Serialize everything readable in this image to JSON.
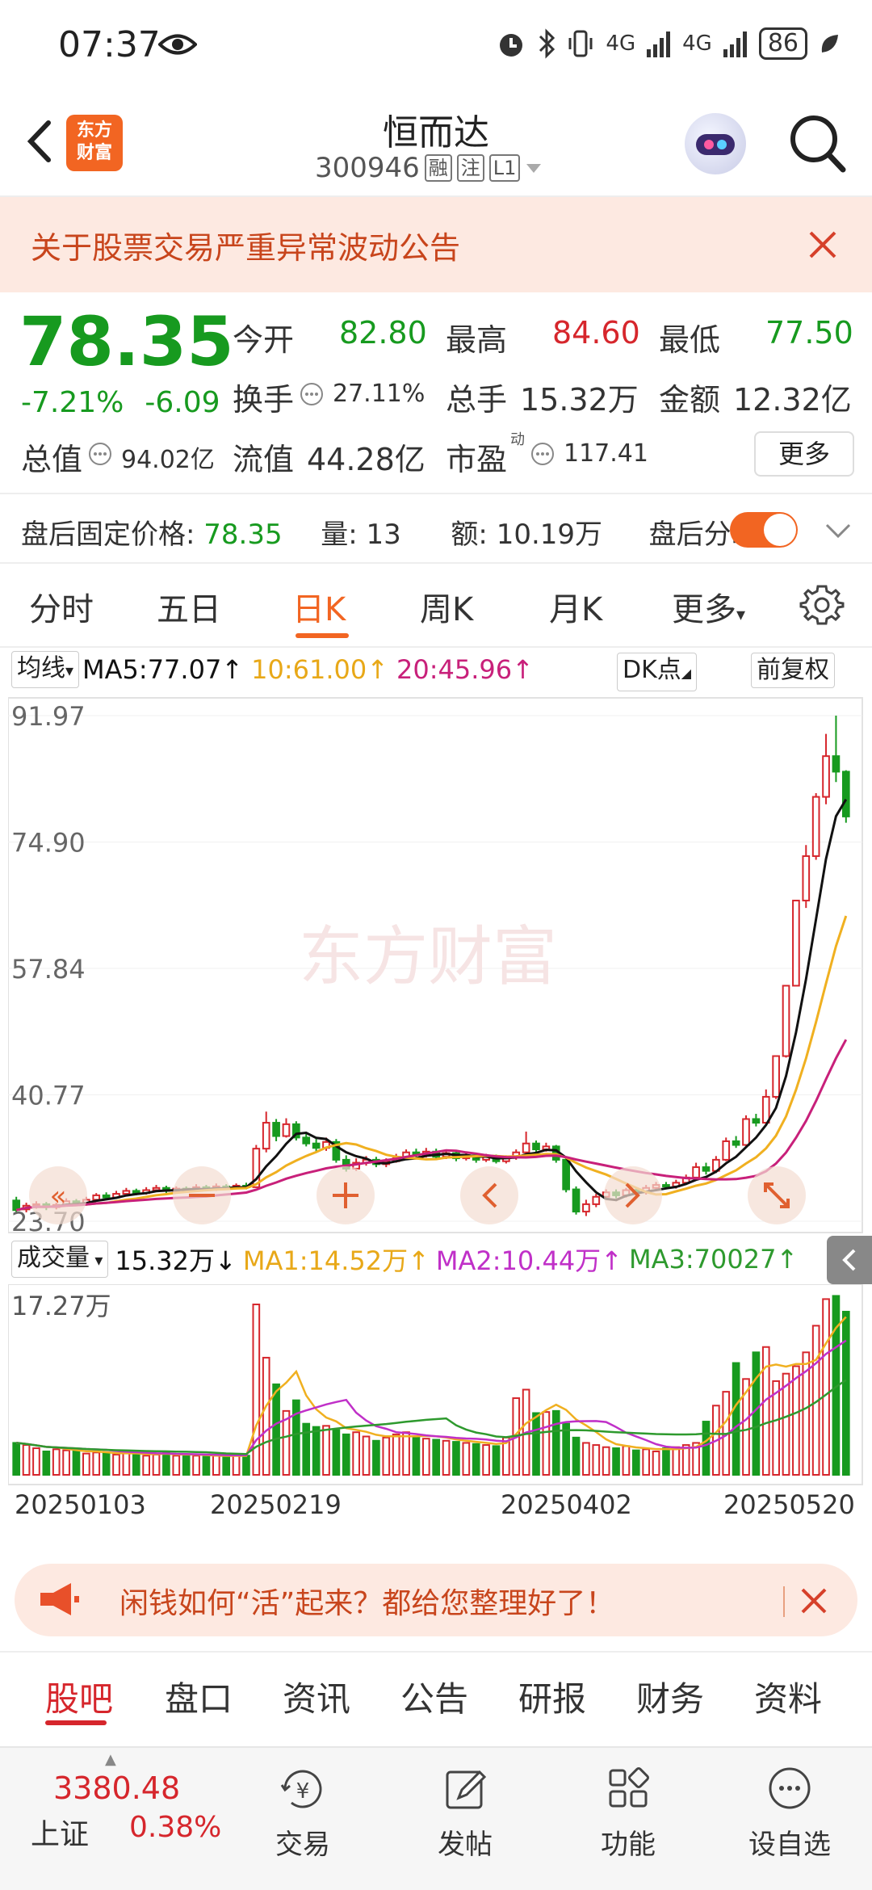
{
  "status_bar": {
    "time": "07:37",
    "network1": "4G",
    "network2": "4G",
    "battery": "86"
  },
  "header": {
    "stock_name": "恒而达",
    "stock_code": "300946",
    "tag_rong": "融",
    "tag_zhu": "注",
    "tag_level": "L1"
  },
  "notice": {
    "text": "关于股票交易严重异常波动公告"
  },
  "quote": {
    "price": "78.35",
    "change_pct": "-7.21%",
    "change": "-6.09",
    "open_label": "今开",
    "open": "82.80",
    "high_label": "最高",
    "high": "84.60",
    "low_label": "最低",
    "low": "77.50",
    "turnover_label": "换手",
    "turnover": "27.11%",
    "vol_label": "总手",
    "vol": "15.32万",
    "amount_label": "金额",
    "amount": "12.32亿",
    "mktcap_label": "总值",
    "mktcap": "94.02亿",
    "float_label": "流值",
    "float": "44.28亿",
    "pe_label": "市盈",
    "pe_sup": "动",
    "pe": "117.41",
    "more_label": "更多"
  },
  "after_hours": {
    "price_label": "盘后固定价格:",
    "price": "78.35",
    "vol_label": "量:",
    "vol": "13",
    "amount_label": "额:",
    "amount": "10.19万",
    "timeshare_label": "盘后分时"
  },
  "chart_tabs": [
    "分时",
    "五日",
    "日K",
    "周K",
    "月K",
    "更多"
  ],
  "active_chart_tab": "日K",
  "ma_row": {
    "selector": "均线",
    "ma5": "MA5:77.07↑",
    "ma10": "10:61.00↑",
    "ma20": "20:45.96↑",
    "dk_label": "DK点",
    "fuquan_label": "前复权"
  },
  "volume_row": {
    "selector": "成交量",
    "vol": "15.32万↓",
    "ma1": "MA1:14.52万↑",
    "ma2": "MA2:10.44万↑",
    "ma3": "MA3:70027↑"
  },
  "watermark": "东方财富",
  "colors": {
    "up": "#d6262c",
    "down": "#179a1f",
    "accent": "#f26522",
    "ma5": "#111111",
    "ma10": "#f0b020",
    "ma20": "#c8207a",
    "ma3": "#2e9a2e"
  },
  "chart_data": {
    "type": "candlestick",
    "y_ticks": [
      "91.97",
      "74.90",
      "57.84",
      "40.77",
      "23.70"
    ],
    "ylim": [
      23.7,
      91.97
    ],
    "vol_max_label": "17.27万",
    "x_tick_labels": [
      "20250103",
      "20250219",
      "20250402",
      "20250520"
    ],
    "candles": [
      [
        26.5,
        25.2,
        27.0,
        24.8
      ],
      [
        25.3,
        25.8,
        26.2,
        24.9
      ],
      [
        25.8,
        26.0,
        26.4,
        25.4
      ],
      [
        26.0,
        25.6,
        26.3,
        25.2
      ],
      [
        25.6,
        25.9,
        26.2,
        25.3
      ],
      [
        25.9,
        26.4,
        26.8,
        25.7
      ],
      [
        26.4,
        26.2,
        26.7,
        25.9
      ],
      [
        26.2,
        26.6,
        27.0,
        26.0
      ],
      [
        26.6,
        27.2,
        27.5,
        26.4
      ],
      [
        27.2,
        26.9,
        27.6,
        26.6
      ],
      [
        26.9,
        27.4,
        27.8,
        26.8
      ],
      [
        27.4,
        27.8,
        28.2,
        27.1
      ],
      [
        27.8,
        27.5,
        28.1,
        27.2
      ],
      [
        27.5,
        27.9,
        28.3,
        27.3
      ],
      [
        27.9,
        28.2,
        28.6,
        27.7
      ],
      [
        28.2,
        27.8,
        28.5,
        27.5
      ],
      [
        27.8,
        28.1,
        28.4,
        27.6
      ],
      [
        28.1,
        27.9,
        28.4,
        27.6
      ],
      [
        27.9,
        28.3,
        28.7,
        27.7
      ],
      [
        28.3,
        28.0,
        28.6,
        27.8
      ],
      [
        28.0,
        28.4,
        28.8,
        27.8
      ],
      [
        28.4,
        28.2,
        28.7,
        27.9
      ],
      [
        28.2,
        28.5,
        28.8,
        28.0
      ],
      [
        28.5,
        28.3,
        28.9,
        28.0
      ],
      [
        28.3,
        33.5,
        34.0,
        28.2
      ],
      [
        33.5,
        37.0,
        38.5,
        33.0
      ],
      [
        37.0,
        35.2,
        37.5,
        34.5
      ],
      [
        35.2,
        36.8,
        37.6,
        35.0
      ],
      [
        36.8,
        35.0,
        37.2,
        34.6
      ],
      [
        35.0,
        34.2,
        35.6,
        33.8
      ],
      [
        34.2,
        33.6,
        34.8,
        33.0
      ],
      [
        33.6,
        34.4,
        35.0,
        33.2
      ],
      [
        34.4,
        32.0,
        34.8,
        31.6
      ],
      [
        32.0,
        30.8,
        32.6,
        30.4
      ],
      [
        30.8,
        31.6,
        32.2,
        30.5
      ],
      [
        31.6,
        32.0,
        32.5,
        31.2
      ],
      [
        32.0,
        31.4,
        32.4,
        31.0
      ],
      [
        31.4,
        31.8,
        32.2,
        31.0
      ],
      [
        31.8,
        32.2,
        32.8,
        31.6
      ],
      [
        32.2,
        33.0,
        33.4,
        32.0
      ],
      [
        33.0,
        32.6,
        33.5,
        32.2
      ],
      [
        32.6,
        33.1,
        33.6,
        32.3
      ],
      [
        33.1,
        32.4,
        33.5,
        32.0
      ],
      [
        32.4,
        32.9,
        33.3,
        32.1
      ],
      [
        32.9,
        32.2,
        33.2,
        31.8
      ],
      [
        32.2,
        32.6,
        33.0,
        31.9
      ],
      [
        32.6,
        32.0,
        32.9,
        31.6
      ],
      [
        32.0,
        32.4,
        32.8,
        31.7
      ],
      [
        32.4,
        31.8,
        32.7,
        31.5
      ],
      [
        31.8,
        32.3,
        32.6,
        31.5
      ],
      [
        32.3,
        33.0,
        33.4,
        32.0
      ],
      [
        33.0,
        34.2,
        35.8,
        32.8
      ],
      [
        34.2,
        33.4,
        34.6,
        33.0
      ],
      [
        33.4,
        33.8,
        34.3,
        33.1
      ],
      [
        33.8,
        32.0,
        34.0,
        31.6
      ],
      [
        32.0,
        28.0,
        32.2,
        27.6
      ],
      [
        28.0,
        25.0,
        28.4,
        24.6
      ],
      [
        25.0,
        26.0,
        26.6,
        24.4
      ],
      [
        26.0,
        27.0,
        27.4,
        25.6
      ],
      [
        27.0,
        27.6,
        28.0,
        26.6
      ],
      [
        27.6,
        27.2,
        28.0,
        26.8
      ],
      [
        27.2,
        27.9,
        28.2,
        26.9
      ],
      [
        27.9,
        27.6,
        28.3,
        27.2
      ],
      [
        27.6,
        28.2,
        28.6,
        27.3
      ],
      [
        28.2,
        28.6,
        29.0,
        27.9
      ],
      [
        28.6,
        28.4,
        29.0,
        28.0
      ],
      [
        28.4,
        28.9,
        29.3,
        28.1
      ],
      [
        28.9,
        29.6,
        30.0,
        28.6
      ],
      [
        29.6,
        31.0,
        31.6,
        29.3
      ],
      [
        31.0,
        30.5,
        31.6,
        30.0
      ],
      [
        30.5,
        32.0,
        32.5,
        30.2
      ],
      [
        32.0,
        34.5,
        35.0,
        31.8
      ],
      [
        34.5,
        34.0,
        35.2,
        33.6
      ],
      [
        34.0,
        37.5,
        38.0,
        33.8
      ],
      [
        37.5,
        37.0,
        38.2,
        36.5
      ],
      [
        37.0,
        40.5,
        41.5,
        36.8
      ],
      [
        40.5,
        46.0,
        46.0,
        40.2
      ],
      [
        46.0,
        55.5,
        55.5,
        45.8
      ],
      [
        55.5,
        67.0,
        67.0,
        55.5
      ],
      [
        67.0,
        73.0,
        74.5,
        66.0
      ],
      [
        73.0,
        81.0,
        81.5,
        72.5
      ],
      [
        81.0,
        86.5,
        89.5,
        80.0
      ],
      [
        86.5,
        84.4,
        91.97,
        83.0
      ],
      [
        84.4,
        78.35,
        84.6,
        77.5
      ]
    ],
    "volumes": [
      3.0,
      2.8,
      2.5,
      2.2,
      2.4,
      2.3,
      2.2,
      2.0,
      2.1,
      2.0,
      1.9,
      2.1,
      2.0,
      1.8,
      1.9,
      2.1,
      1.8,
      1.9,
      1.8,
      1.7,
      1.8,
      1.7,
      1.9,
      1.8,
      16.0,
      11.0,
      8.5,
      6.0,
      7.0,
      4.8,
      4.5,
      4.6,
      4.2,
      3.8,
      4.0,
      3.6,
      3.2,
      3.5,
      3.8,
      4.0,
      3.6,
      3.4,
      3.3,
      3.2,
      3.1,
      3.0,
      2.9,
      2.8,
      2.7,
      3.5,
      7.2,
      8.0,
      5.8,
      5.9,
      6.0,
      4.8,
      3.5,
      3.0,
      2.8,
      2.6,
      2.5,
      2.7,
      2.3,
      2.4,
      2.2,
      2.5,
      2.6,
      2.8,
      3.0,
      5.0,
      6.5,
      7.8,
      10.5,
      9.0,
      11.5,
      12.0,
      8.8,
      9.5,
      10.2,
      11.5,
      14.0,
      16.5,
      16.8,
      15.32
    ]
  },
  "banner": {
    "text": "闲钱如何“活”起来？都给您整理好了！"
  },
  "bottom_tabs": [
    "股吧",
    "盘口",
    "资讯",
    "公告",
    "研报",
    "财务",
    "资料"
  ],
  "bottom_nav": {
    "index_value": "3380.48",
    "index_name": "上证",
    "index_pct": "0.38%",
    "trade": "交易",
    "post": "发帖",
    "functions": "功能",
    "watchlist": "设自选"
  }
}
